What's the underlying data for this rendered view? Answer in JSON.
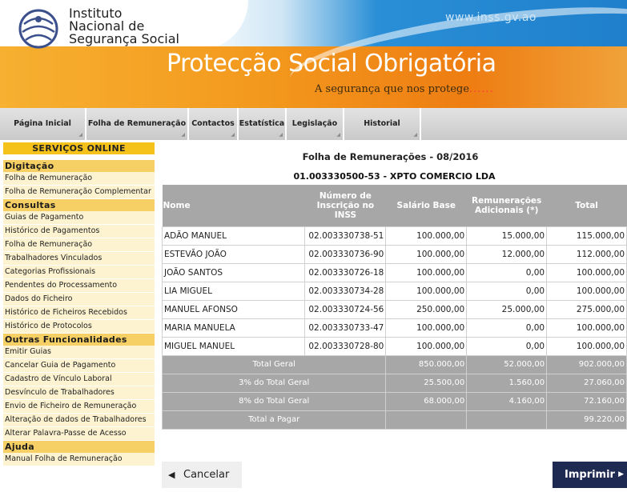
{
  "header": {
    "org_line1": "Instituto",
    "org_line2": "Nacional de",
    "org_line3": "Segurança Social",
    "site_url": "www.inss.gv.ao",
    "banner_title": "Protecção Social Obrigatória",
    "banner_subtitle": "A segurança que nos protege",
    "banner_dots": "......"
  },
  "nav": {
    "tabs": [
      {
        "label": "Página Inicial"
      },
      {
        "label": "Folha de Remuneração"
      },
      {
        "label": "Contactos"
      },
      {
        "label": "Estatística"
      },
      {
        "label": "Legislação"
      },
      {
        "label": "Historial"
      }
    ]
  },
  "sidebar": {
    "title": "SERVIÇOS ONLINE",
    "sections": [
      {
        "title": "Digitação",
        "items": [
          "Folha de Remuneração",
          "Folha de Remuneração Complementar"
        ]
      },
      {
        "title": "Consultas",
        "items": [
          "Guias de Pagamento",
          "Histórico de Pagamentos",
          "Folha de Remuneração",
          "Trabalhadores Vinculados",
          "Categorias Profissionais",
          "Pendentes do Processamento",
          "Dados do Ficheiro",
          "Histórico de Ficheiros Recebidos",
          "Histórico de Protocolos"
        ]
      },
      {
        "title": "Outras Funcionalidades",
        "items": [
          "Emitir Guias",
          "Cancelar Guia de Pagamento",
          "Cadastro de Vínculo Laboral",
          "Desvínculo de Trabalhadores",
          "Envio de Ficheiro de Remuneração",
          "Alteração de dados de Trabalhadores",
          "Alterar Palavra-Passe de Acesso"
        ]
      },
      {
        "title": "Ajuda",
        "items": [
          "Manual Folha de Remuneração"
        ]
      }
    ]
  },
  "main": {
    "page_title": "Folha de Remunerações - 08/2016",
    "company": "01.003330500-53 - XPTO COMERCIO LDA",
    "columns": [
      "Nome",
      "Número de Inscrição no INSS",
      "Salário Base",
      "Remunerações Adicionais (*)",
      "Total"
    ],
    "rows": [
      [
        "ADÃO MANUEL",
        "02.003330738-51",
        "100.000,00",
        "15.000,00",
        "115.000,00"
      ],
      [
        "ESTEVÃO JOÃO",
        "02.003330736-90",
        "100.000,00",
        "12.000,00",
        "112.000,00"
      ],
      [
        "JOÃO SANTOS",
        "02.003330726-18",
        "100.000,00",
        "0,00",
        "100.000,00"
      ],
      [
        "LIA MIGUEL",
        "02.003330734-28",
        "100.000,00",
        "0,00",
        "100.000,00"
      ],
      [
        "MANUEL AFONSO",
        "02.003330724-56",
        "250.000,00",
        "25.000,00",
        "275.000,00"
      ],
      [
        "MARIA MANUELA",
        "02.003330733-47",
        "100.000,00",
        "0,00",
        "100.000,00"
      ],
      [
        "MIGUEL MANUEL",
        "02.003330728-80",
        "100.000,00",
        "0,00",
        "100.000,00"
      ]
    ],
    "totals": [
      {
        "label": "Total Geral",
        "base": "850.000,00",
        "adicionais": "52.000,00",
        "total": "902.000,00"
      },
      {
        "label": "3% do Total Geral",
        "base": "25.500,00",
        "adicionais": "1.560,00",
        "total": "27.060,00"
      },
      {
        "label": "8% do Total Geral",
        "base": "68.000,00",
        "adicionais": "4.160,00",
        "total": "72.160,00"
      },
      {
        "label": "Total a Pagar",
        "base": "",
        "adicionais": "",
        "total": "99.220,00"
      }
    ]
  },
  "buttons": {
    "cancel": "Cancelar",
    "print": "Imprimir"
  },
  "colors": {
    "nav_gray": "#c9c9c9",
    "sidebar_header": "#f5c21b",
    "sidebar_section": "#f7d065",
    "sidebar_item": "#fdf3d0",
    "table_header": "#a7a7a7",
    "print_button": "#1f2a52"
  }
}
